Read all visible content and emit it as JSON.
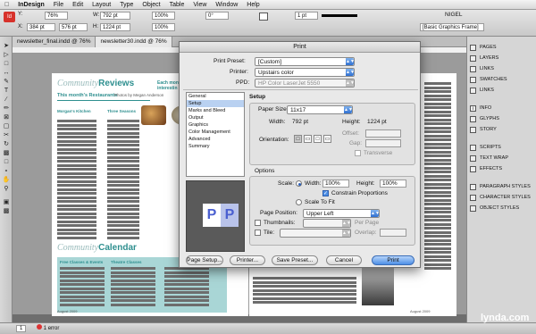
{
  "menubar": {
    "apple": "",
    "app_name": "InDesign",
    "items": [
      "File",
      "Edit",
      "Layout",
      "Type",
      "Object",
      "Table",
      "View",
      "Window",
      "Help"
    ],
    "zoom": "76%",
    "user": "NIGEL",
    "workspace": "[Basic Graphics Frame]"
  },
  "control": {
    "x": "384 pt",
    "y": "576 pt",
    "w": "792 pt",
    "h": "1224 pt",
    "stroke": "1 pt",
    "percent1": "100%",
    "percent2": "100%",
    "angle": "0°"
  },
  "tabs": [
    "newsletter_final.indd @ 76%",
    "newsletter30.indd @ 76%"
  ],
  "document": {
    "left_title_a": "Community",
    "left_title_b": "Reviews",
    "left_subhead": "This month's Restaurants",
    "left_byline": "Photos by Megan Anderson",
    "left_side_a": "Each month",
    "left_side_b": "interestin",
    "col1_head": "Morgan's Kitchen",
    "col2_head": "Three Seasons",
    "cal_title_a": "Community",
    "cal_title_b": "Calendar",
    "cal_sub": "Free Classes & Events",
    "cal_col": "Theatre Classes",
    "footer_left": "August 2009",
    "footer_right": "August 2009"
  },
  "status": {
    "page": "1",
    "errors": "1 error"
  },
  "panels": {
    "items": [
      "PAGES",
      "LAYERS",
      "LINKS",
      "SWATCHES",
      "LINKS",
      "INFO",
      "GLYPHS",
      "STORY",
      "SCRIPTS",
      "TEXT WRAP",
      "EFFECTS",
      "PARAGRAPH STYLES",
      "CHARACTER STYLES",
      "OBJECT STYLES"
    ]
  },
  "dialog": {
    "title": "Print",
    "print_preset_label": "Print Preset:",
    "print_preset": "[Custom]",
    "printer_label": "Printer:",
    "printer": "Upstairs color",
    "ppd_label": "PPD:",
    "ppd": "HP Color LaserJet 5550",
    "categories": [
      "General",
      "Setup",
      "Marks and Bleed",
      "Output",
      "Graphics",
      "Color Management",
      "Advanced",
      "Summary"
    ],
    "section_title": "Setup",
    "paper_size_label": "Paper Size:",
    "paper_size": "11x17",
    "width_label": "Width:",
    "width": "792 pt",
    "height_label": "Height:",
    "height": "1224 pt",
    "offset_label": "Offset:",
    "gap_label": "Gap:",
    "orientation_label": "Orientation:",
    "transverse_label": "Transverse",
    "options_title": "Options",
    "scale_label": "Scale:",
    "scale_width_label": "Width:",
    "scale_width": "100%",
    "scale_height_label": "Height:",
    "scale_height": "100%",
    "constrain_label": "Constrain Proportions",
    "scale_to_fit_label": "Scale To Fit",
    "page_position_label": "Page Position:",
    "page_position": "Upper Left",
    "thumbnails_label": "Thumbnails:",
    "per_page_label": "Per Page",
    "tile_label": "Tile:",
    "overlap_label": "Overlap:",
    "preview_letter": "P",
    "buttons": {
      "page_setup": "Page Setup...",
      "printer": "Printer...",
      "save_preset": "Save Preset...",
      "cancel": "Cancel",
      "print": "Print"
    }
  },
  "watermark": "lynda.com",
  "colors": {
    "accent": "#4d8fe6",
    "teal": "#3aa6a6",
    "teal_text": "#2e8f8f"
  }
}
